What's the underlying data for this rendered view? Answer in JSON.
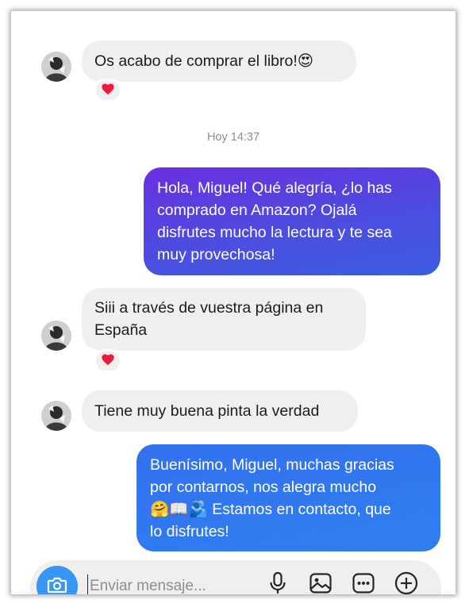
{
  "conversation": {
    "messages": [
      {
        "id": "m1",
        "direction": "incoming",
        "text_lines": [
          "Os acabo de comprar el libro!😍"
        ],
        "reaction": "❤️"
      },
      {
        "id": "m2",
        "direction": "outgoing",
        "text_lines": [
          "Hola, Miguel! Qué alegría, ¿lo has",
          "comprado en Amazon? Ojalá",
          "disfrutes mucho la lectura y te sea",
          "muy provechosa!"
        ]
      },
      {
        "id": "m3",
        "direction": "incoming",
        "text_lines": [
          "Siii a través de vuestra página en",
          "España"
        ],
        "reaction": "❤️"
      },
      {
        "id": "m4",
        "direction": "incoming",
        "text_lines": [
          "Tiene muy buena pinta la verdad"
        ]
      },
      {
        "id": "m5",
        "direction": "outgoing",
        "text_lines": [
          "Buenísimo, Miguel, muchas gracias",
          "por contarnos, nos alegra mucho",
          "🤗📖🫂 Estamos en contacto, que",
          "lo disfrutes!"
        ]
      }
    ],
    "timestamp": "Hoy 14:37"
  },
  "composer": {
    "placeholder": "Enviar mensaje...",
    "value": "",
    "icons": [
      "camera-icon",
      "microphone-icon",
      "gallery-icon",
      "sticker-icon",
      "plus-icon"
    ]
  },
  "colors": {
    "incoming_bubble": "#efefef",
    "outgoing_gradient_purple": "#6a2fe0",
    "outgoing_gradient_blue": "#3b5ee0",
    "outgoing_blue": "#2f7ff0",
    "accent": "#3797f0",
    "timestamp_text": "#8e8e8e",
    "heart": "#ed1c3c"
  }
}
